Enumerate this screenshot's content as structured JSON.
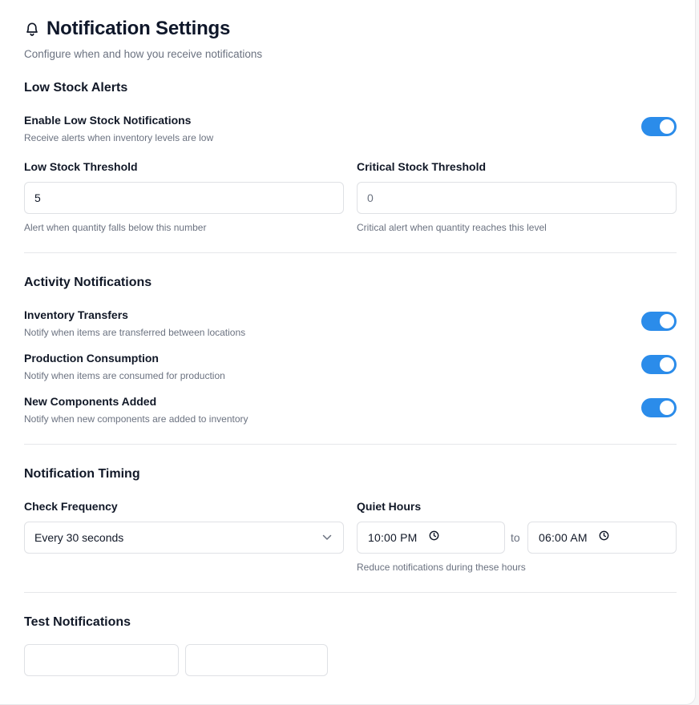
{
  "header": {
    "icon": "bell-icon",
    "title": "Notification Settings",
    "subtitle": "Configure when and how you receive notifications"
  },
  "low_stock": {
    "title": "Low Stock Alerts",
    "enable": {
      "label": "Enable Low Stock Notifications",
      "description": "Receive alerts when inventory levels are low",
      "enabled": true
    },
    "low_threshold": {
      "label": "Low Stock Threshold",
      "value": "5",
      "hint": "Alert when quantity falls below this number"
    },
    "critical_threshold": {
      "label": "Critical Stock Threshold",
      "placeholder": "0",
      "hint": "Critical alert when quantity reaches this level"
    }
  },
  "activity": {
    "title": "Activity Notifications",
    "items": [
      {
        "label": "Inventory Transfers",
        "description": "Notify when items are transferred between locations",
        "enabled": true
      },
      {
        "label": "Production Consumption",
        "description": "Notify when items are consumed for production",
        "enabled": true
      },
      {
        "label": "New Components Added",
        "description": "Notify when new components are added to inventory",
        "enabled": true
      }
    ]
  },
  "timing": {
    "title": "Notification Timing",
    "frequency": {
      "label": "Check Frequency",
      "value": "Every 30 seconds"
    },
    "quiet_hours": {
      "label": "Quiet Hours",
      "start": "10:00 PM",
      "separator": "to",
      "end": "06:00 AM",
      "hint": "Reduce notifications during these hours"
    }
  },
  "test": {
    "title": "Test Notifications"
  },
  "colors": {
    "toggle_on": "#2b8cea",
    "border": "#dfe1e5",
    "muted_text": "#6b7280"
  }
}
